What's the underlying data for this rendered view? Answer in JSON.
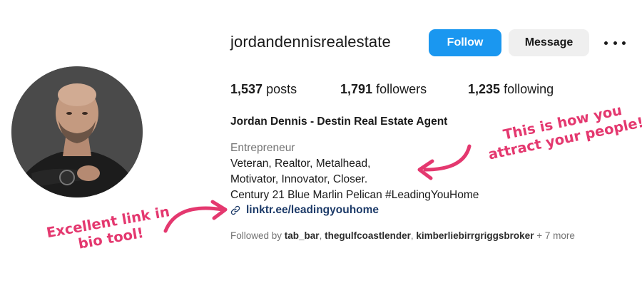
{
  "profile": {
    "username": "jordandennisrealestate",
    "follow_label": "Follow",
    "message_label": "Message",
    "more_icon": "more-options-icon",
    "posts_count": "1,537",
    "posts_label": "posts",
    "followers_count": "1,791",
    "followers_label": "followers",
    "following_count": "1,235",
    "following_label": "following",
    "full_name": "Jordan Dennis - Destin Real Estate Agent",
    "category": "Entrepreneur",
    "bio_lines": [
      "Veteran, Realtor, Metalhead,",
      "Motivator, Innovator, Closer.",
      "Century 21 Blue Marlin Pelican #LeadingYouHome"
    ],
    "link_icon": "link-icon",
    "link_text": "linktr.ee/leadingyouhome",
    "followed_by_prefix": "Followed by ",
    "followed_by_names": [
      "tab_bar",
      "thegulfcoastlender",
      "kimberliebirrgriggsbroker"
    ],
    "followed_by_separator": ", ",
    "followed_by_suffix": " + 7 more"
  },
  "annotations": {
    "right_line1": "This is how you",
    "right_line2": "attract your people!",
    "left_line1": "Excellent link in",
    "left_line2": "bio tool!"
  },
  "colors": {
    "follow_button": "#1a97f0",
    "message_button": "#efefef",
    "link": "#1d3b69",
    "muted": "#737373",
    "annotation": "#e4386f"
  }
}
